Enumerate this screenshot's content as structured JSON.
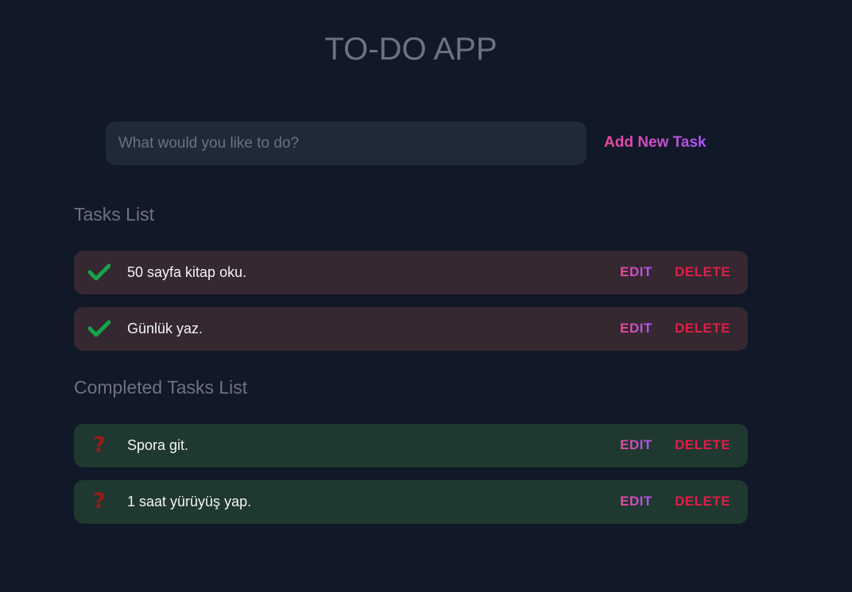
{
  "app": {
    "title": "TO-DO APP"
  },
  "new_task": {
    "placeholder": "What would you like to do?",
    "value": "",
    "add_button_label": "Add New Task"
  },
  "tasks_section": {
    "title": "Tasks List",
    "items": [
      {
        "text": "50 sayfa kitap oku.",
        "status_icon": "checkmark-icon",
        "edit_label": "EDIT",
        "delete_label": "DELETE"
      },
      {
        "text": "Günlük yaz.",
        "status_icon": "checkmark-icon",
        "edit_label": "EDIT",
        "delete_label": "DELETE"
      }
    ]
  },
  "completed_section": {
    "title": "Completed Tasks List",
    "items": [
      {
        "text": "Spora git.",
        "status_icon": "question-mark-icon",
        "edit_label": "EDIT",
        "delete_label": "DELETE"
      },
      {
        "text": "1 saat yürüyüş yap.",
        "status_icon": "question-mark-icon",
        "edit_label": "EDIT",
        "delete_label": "DELETE"
      }
    ]
  },
  "colors": {
    "background": "#111827",
    "input_background": "#1f2937",
    "muted_text": "#6b7280",
    "pending_row": "#352830",
    "completed_row": "#1f3830",
    "accent_gradient_start": "#ec4899",
    "accent_gradient_end": "#a855f7",
    "delete": "#e11d48",
    "check": "#16a34a",
    "question": "#991b1b"
  }
}
